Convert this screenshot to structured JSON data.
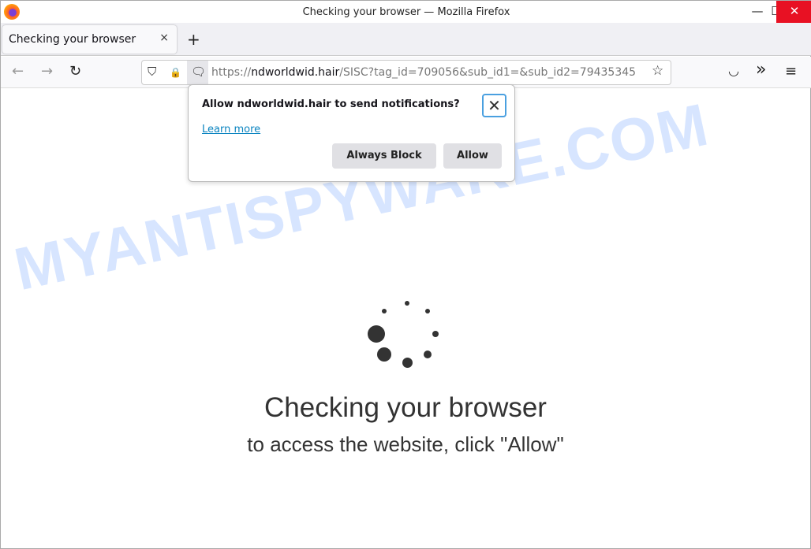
{
  "window": {
    "title": "Checking your browser — Mozilla Firefox",
    "minimize": "—",
    "maximize": "☐",
    "close": "✕",
    "close_color": "#e81123"
  },
  "tab": {
    "label": "Checking your browser",
    "close": "×",
    "new_tab": "+"
  },
  "nav": {
    "back": "←",
    "forward": "→",
    "reload": "↻",
    "shield": "⛉",
    "lock": "🔒",
    "notif": "🗨",
    "url_prefix": "https://",
    "url_domain": "ndworldwid.hair",
    "url_path": "/SISC?tag_id=709056&sub_id1=&sub_id2=79435345",
    "star": "☆",
    "pocket": "◡",
    "overflow": "»",
    "menu": "≡"
  },
  "popup": {
    "question": "Allow ndworldwid.hair to send notifications?",
    "close": "✕",
    "learn_more": "Learn more",
    "block": "Always Block",
    "allow": "Allow"
  },
  "page": {
    "heading": "Checking your browser",
    "subheading": "to access the website, click \"Allow\"",
    "watermark": "MYANTISPYWARE.COM"
  }
}
